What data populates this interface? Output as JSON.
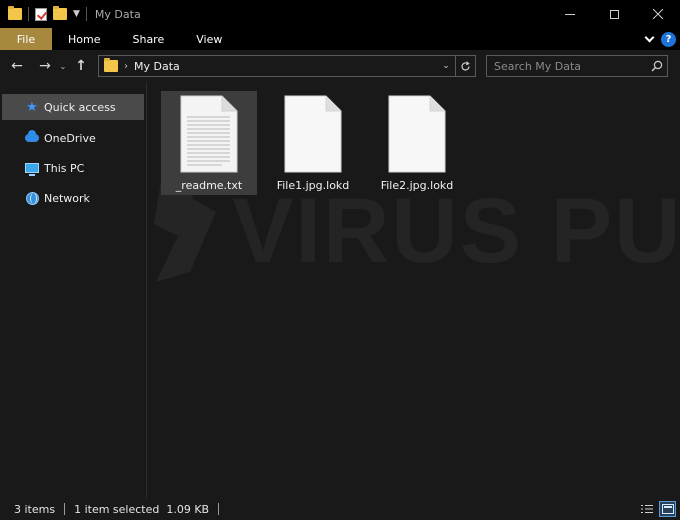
{
  "window": {
    "title": "My Data"
  },
  "ribbon": {
    "tabs": [
      "File",
      "Home",
      "Share",
      "View"
    ],
    "help_label": "?"
  },
  "address": {
    "path": "My Data",
    "search_placeholder": "Search My Data"
  },
  "sidebar": {
    "items": [
      {
        "label": "Quick access",
        "icon": "star-icon"
      },
      {
        "label": "OneDrive",
        "icon": "cloud-icon"
      },
      {
        "label": "This PC",
        "icon": "computer-icon"
      },
      {
        "label": "Network",
        "icon": "network-icon"
      }
    ]
  },
  "files": [
    {
      "name": "_readme.txt",
      "icon": "text-document-icon",
      "selected": true
    },
    {
      "name": "File1.jpg.lokd",
      "icon": "blank-file-icon",
      "selected": false
    },
    {
      "name": "File2.jpg.lokd",
      "icon": "blank-file-icon",
      "selected": false
    }
  ],
  "watermark": "VIRUS PUP",
  "status": {
    "item_count": "3 items",
    "selection": "1 item selected",
    "size": "1.09 KB"
  },
  "colors": {
    "background": "#191919",
    "titlebar": "#000000",
    "file_tab": "#a6883f",
    "selection": "#3d3d3d",
    "accent": "#1e74d6"
  }
}
